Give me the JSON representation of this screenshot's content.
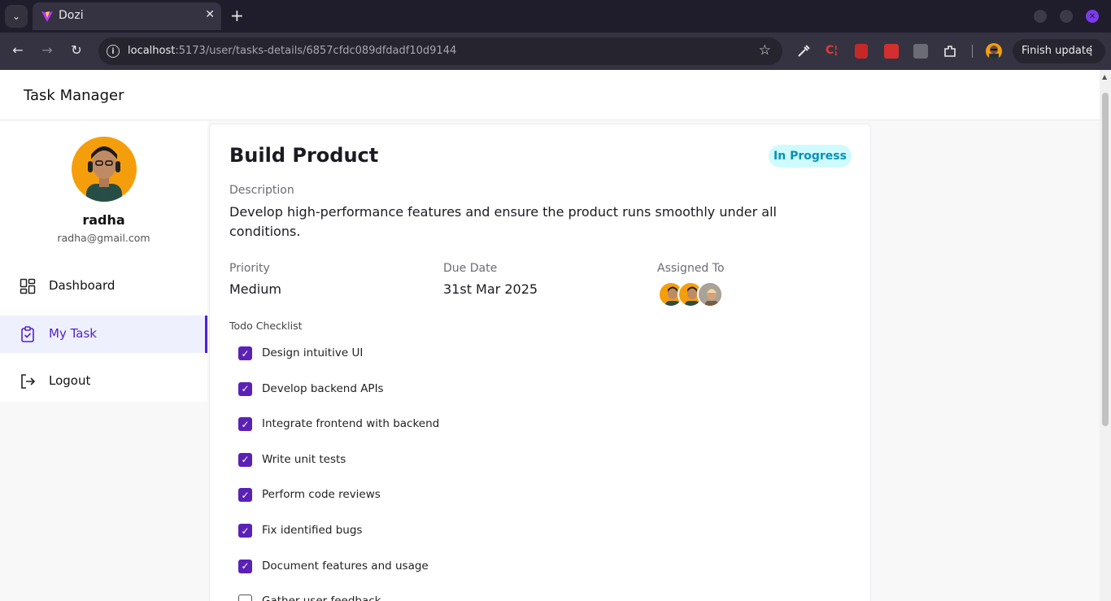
{
  "browser": {
    "tab_title": "Dozi",
    "url_host": "localhost",
    "url_path": ":5173/user/tasks-details/6857cfdc089dfdadf10d9144",
    "finish_update_label": "Finish update"
  },
  "app": {
    "title": "Task Manager"
  },
  "user": {
    "name": "radha",
    "email": "radha@gmail.com"
  },
  "sidebar": {
    "items": [
      {
        "label": "Dashboard",
        "icon": "dashboard-icon",
        "active": false
      },
      {
        "label": "My Task",
        "icon": "clipboard-check-icon",
        "active": true
      },
      {
        "label": "Logout",
        "icon": "logout-icon",
        "active": false
      }
    ]
  },
  "task": {
    "title": "Build Product",
    "status": "In Progress",
    "description_label": "Description",
    "description": "Develop high-performance features and ensure the product runs smoothly under all conditions.",
    "priority_label": "Priority",
    "priority": "Medium",
    "due_date_label": "Due Date",
    "due_date": "31st Mar 2025",
    "assigned_label": "Assigned To",
    "checklist_label": "Todo Checklist",
    "checklist": [
      {
        "text": "Design intuitive UI",
        "done": true
      },
      {
        "text": "Develop backend APIs",
        "done": true
      },
      {
        "text": "Integrate frontend with backend",
        "done": true
      },
      {
        "text": "Write unit tests",
        "done": true
      },
      {
        "text": "Perform code reviews",
        "done": true
      },
      {
        "text": "Fix identified bugs",
        "done": true
      },
      {
        "text": "Document features and usage",
        "done": true
      },
      {
        "text": "Gather user feedback",
        "done": false
      }
    ]
  },
  "colors": {
    "accent": "#4f1fd6",
    "status_bg": "#cffafe",
    "status_text": "#0891b2"
  }
}
